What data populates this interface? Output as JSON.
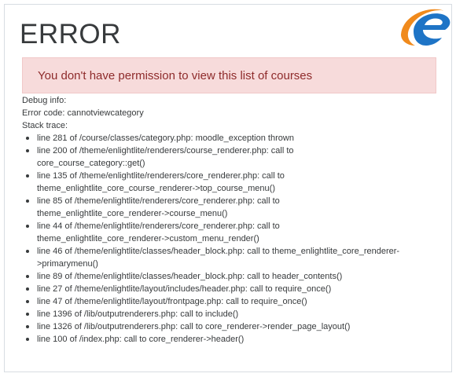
{
  "error": {
    "title": "ERROR",
    "message": "You don't have permission to view this list of courses"
  },
  "debug": {
    "info_label": "Debug info:",
    "error_code": "Error code: cannotviewcategory",
    "stack_label": "Stack trace:",
    "trace": [
      "line 281 of /course/classes/category.php: moodle_exception thrown",
      "line 200 of /theme/enlightlite/renderers/course_renderer.php: call to\ncore_course_category::get()",
      "line 135 of /theme/enlightlite/renderers/core_renderer.php: call to\ntheme_enlightlite_core_course_renderer->top_course_menu()",
      "line 85 of /theme/enlightlite/renderers/core_renderer.php: call to\ntheme_enlightlite_core_renderer->course_menu()",
      "line 44 of /theme/enlightlite/renderers/core_renderer.php: call to\ntheme_enlightlite_core_renderer->custom_menu_render()",
      "line 46 of /theme/enlightlite/classes/header_block.php: call to theme_enlightlite_core_renderer-\n>primarymenu()",
      "line 89 of /theme/enlightlite/classes/header_block.php: call to header_contents()",
      "line 27 of /theme/enlightlite/layout/includes/header.php: call to require_once()",
      "line 47 of /theme/enlightlite/layout/frontpage.php: call to require_once()",
      "line 1396 of /lib/outputrenderers.php: call to include()",
      "line 1326 of /lib/outputrenderers.php: call to core_renderer->render_page_layout()",
      "line 100 of /index.php: call to core_renderer->header()"
    ]
  },
  "logo": {
    "icon": "enlightlite-e-logo",
    "colors": {
      "blue": "#1e74c6",
      "orange": "#f08a1c"
    }
  },
  "colors": {
    "alert_bg": "#f7dbdb",
    "alert_text": "#8e2b2b",
    "text": "#373a3c",
    "border": "#d8dde2"
  }
}
